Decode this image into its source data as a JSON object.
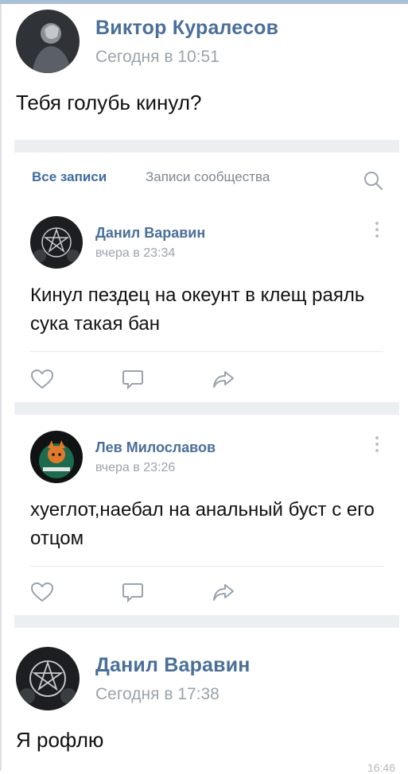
{
  "message_top": {
    "author": "Виктор Куралесов",
    "time": "Сегодня в 10:51",
    "text": "Тебя голубь кинул?"
  },
  "embed": {
    "tabs": [
      {
        "label": "Все записи",
        "active": true
      },
      {
        "label": "Записи сообщества",
        "active": false
      }
    ],
    "search_icon": "search-icon",
    "posts": [
      {
        "author": "Данил Варавин",
        "time": "вчера в 23:34",
        "text": "Кинул пездец на океунт в клещ раяль сука такая бан"
      },
      {
        "author": "Лев Милославов",
        "time": "вчера в 23:26",
        "text": "хуеглот,наебал на анальный буст с его отцом"
      }
    ],
    "action_icons": [
      "like-icon",
      "comment-icon",
      "share-icon"
    ]
  },
  "message_bottom": {
    "author": "Данил Варавин",
    "time": "Сегодня в 17:38",
    "text": "Я рофлю"
  },
  "clock": "16:46",
  "colors": {
    "link": "#4a6f99",
    "accent": "#5181b8",
    "muted": "#9ba3ab",
    "embed_bg": "#eceff2"
  }
}
